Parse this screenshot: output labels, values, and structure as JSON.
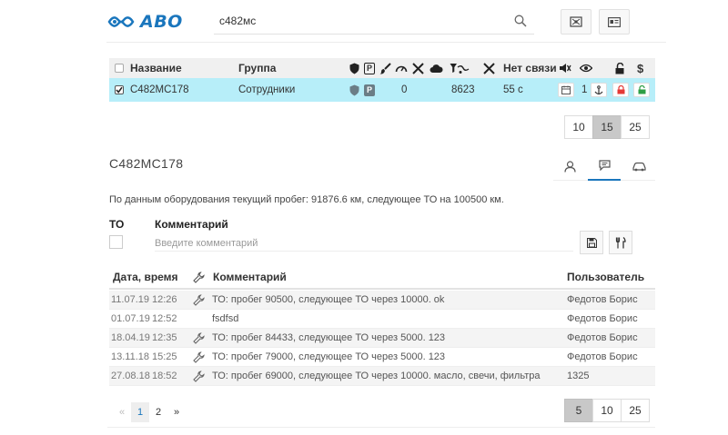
{
  "header": {
    "logo_text": "АВО",
    "search_value": "с482мс",
    "icons": [
      "search-icon",
      "map-route-icon",
      "id-card-icon"
    ]
  },
  "objects_table": {
    "columns": {
      "name": "Название",
      "group": "Группа",
      "no_link": "Нет связи"
    },
    "rows": [
      {
        "selected": true,
        "name": "С482МС178",
        "group": "Сотрудники",
        "speed": "0",
        "mileage": "8623",
        "no_link": "55 с",
        "counter": "1"
      }
    ],
    "page_sizes": [
      "10",
      "15",
      "25"
    ],
    "page_size_active": "15"
  },
  "detail": {
    "title": "С482МС178",
    "tabs": [
      "driver-icon",
      "comments-icon",
      "car-icon"
    ],
    "active_tab": "comments-icon",
    "info_text": "По данным оборудования текущий пробег: 91876.6 км, следующее ТО на 100500 км.",
    "to_label": "ТО",
    "comment_label": "Комментарий",
    "comment_placeholder": "Введите комментарий"
  },
  "history": {
    "columns": {
      "datetime": "Дата, время",
      "comment": "Комментарий",
      "user": "Пользователь"
    },
    "rows": [
      {
        "date": "11.07.19",
        "time": "12:26",
        "to": true,
        "comment": "ТО: пробег 90500, следующее ТО через 10000. ok",
        "user": "Федотов Борис"
      },
      {
        "date": "01.07.19",
        "time": "12:52",
        "to": false,
        "comment": "fsdfsd",
        "user": "Федотов Борис"
      },
      {
        "date": "18.04.19",
        "time": "12:35",
        "to": true,
        "comment": "ТО: пробег 84433, следующее ТО через 5000. 123",
        "user": "Федотов Борис"
      },
      {
        "date": "13.11.18",
        "time": "15:25",
        "to": true,
        "comment": "ТО: пробег 79000, следующее ТО через 5000. 123",
        "user": "Федотов Борис"
      },
      {
        "date": "27.08.18",
        "time": "18:52",
        "to": true,
        "comment": "ТО: пробег 69000, следующее ТО через 10000. масло, свечи, фильтра",
        "user": "1325"
      }
    ],
    "pager": {
      "prev": "«",
      "pages": [
        "1",
        "2"
      ],
      "current": "1",
      "next": "»"
    },
    "page_sizes": [
      "5",
      "10",
      "25"
    ],
    "page_size_active": "5"
  },
  "colors": {
    "accent": "#1a76bd",
    "selected_row": "#b7eef9",
    "lock_red": "#e53935",
    "lock_green": "#2e9e44"
  }
}
